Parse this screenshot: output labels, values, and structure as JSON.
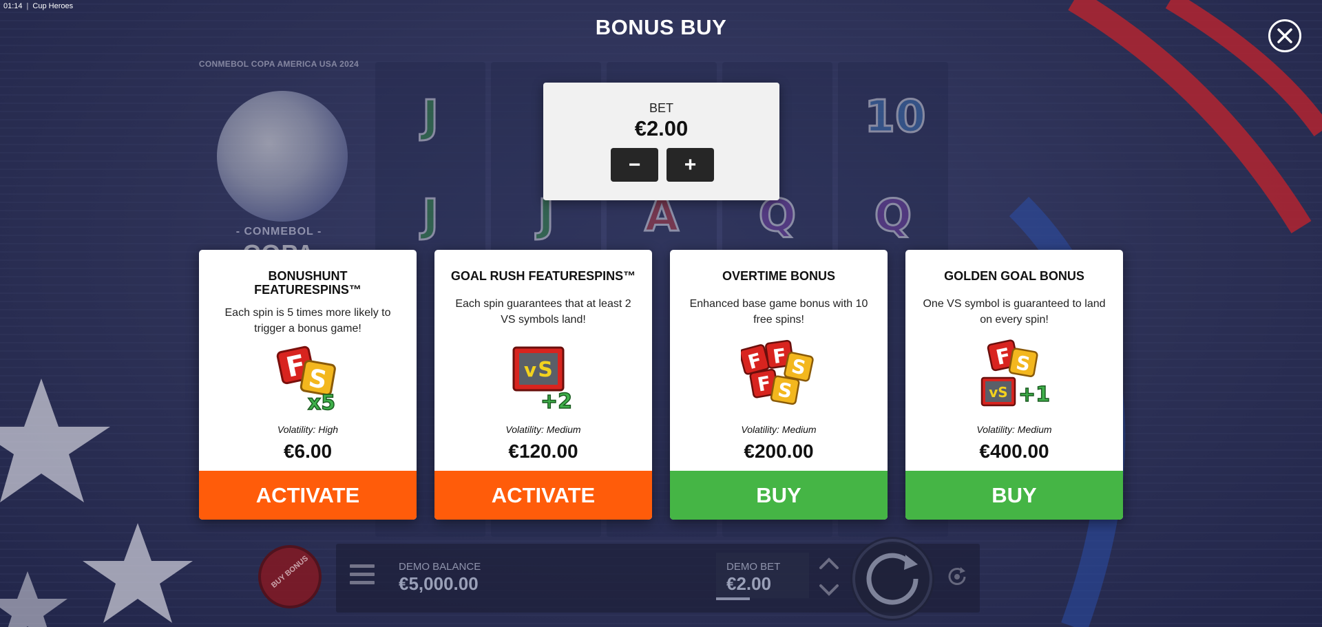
{
  "status_bar": {
    "time": "01:14",
    "separator": "|",
    "app_name": "Cup Heroes"
  },
  "header": {
    "title": "BONUS BUY",
    "close_icon": "close-icon"
  },
  "background_logo": {
    "top_text": "CONMEBOL COPA AMERICA USA 2024",
    "conmebol": "- CONMEBOL -",
    "copa": "COPA AMERICA",
    "tm": "™"
  },
  "reel_symbols": [
    "J",
    "J",
    "J",
    "A",
    "Q",
    "10",
    "Q"
  ],
  "bet_panel": {
    "label": "BET",
    "value": "€2.00",
    "minus_label": "−",
    "plus_label": "+"
  },
  "cards": [
    {
      "title": "BONUSHUNT FEATURESPINS™",
      "description": "Each spin is 5 times more likely to trigger a bonus game!",
      "icon": "fs-x5-icon",
      "volatility": "Volatility: High",
      "price": "€6.00",
      "button": "ACTIVATE"
    },
    {
      "title": "GOAL RUSH FEATURESPINS™",
      "description": "Each spin guarantees that at least 2 VS symbols land!",
      "icon": "vs-plus2-icon",
      "volatility": "Volatility: Medium",
      "price": "€120.00",
      "button": "ACTIVATE"
    },
    {
      "title": "OVERTIME BONUS",
      "description": "Enhanced base game bonus with 10 free spins!",
      "icon": "ffss-icon",
      "volatility": "Volatility: Medium",
      "price": "€200.00",
      "button": "BUY"
    },
    {
      "title": "GOLDEN GOAL BONUS",
      "description": "One VS symbol is guaranteed to land on every spin!",
      "icon": "fs-vs-plus1-icon",
      "volatility": "Volatility: Medium",
      "price": "€400.00",
      "button": "BUY"
    }
  ],
  "bottom_bar": {
    "buy_bonus_label": "BUY BONUS",
    "demo_balance_label": "DEMO BALANCE",
    "demo_balance_value": "€5,000.00",
    "demo_bet_label": "DEMO BET",
    "demo_bet_value": "€2.00"
  },
  "colors": {
    "activate": "#ff5c0a",
    "buy": "#45b545",
    "background": "#2b2f52"
  }
}
